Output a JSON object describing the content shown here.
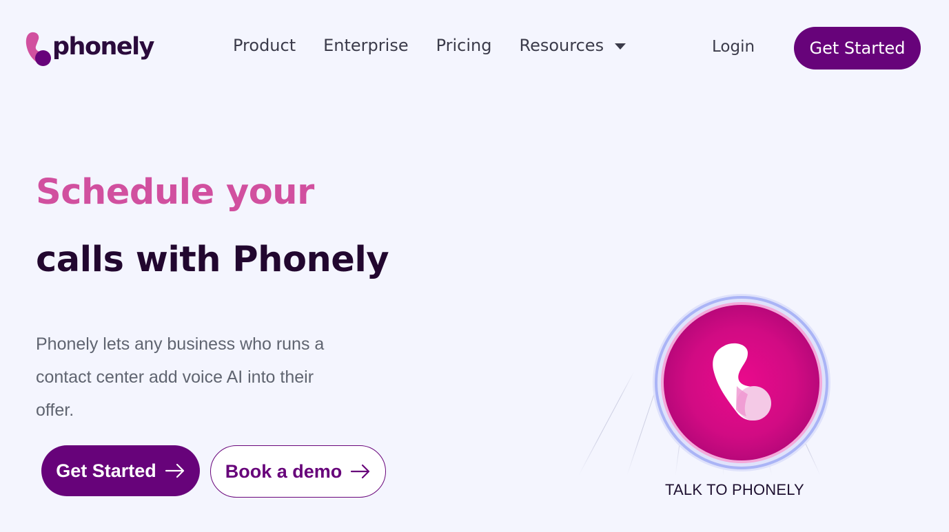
{
  "brand": {
    "name": "phonely",
    "colors": {
      "primary": "#67037a",
      "accent_pink": "#d1509f",
      "heading_dark": "#22072f",
      "background": "#f4f5fe"
    }
  },
  "header": {
    "nav": [
      {
        "label": "Product"
      },
      {
        "label": "Enterprise"
      },
      {
        "label": "Pricing"
      },
      {
        "label": "Resources",
        "icon": "caret-down-icon"
      }
    ],
    "login_label": "Login",
    "cta_label": "Get Started"
  },
  "hero": {
    "rotating_text": "Schedule your",
    "title_rest": "calls with Phonely",
    "description": "Phonely lets any business who runs a contact center add voice AI into their offer.",
    "primary_cta": "Get Started",
    "secondary_cta": "Book a demo"
  },
  "talk_widget": {
    "label": "TALK TO PHONELY"
  }
}
